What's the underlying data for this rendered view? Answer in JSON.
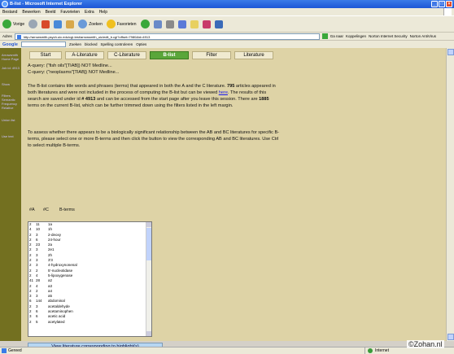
{
  "window": {
    "title": "B-list - Microsoft Internet Explorer"
  },
  "menu": [
    "Bestand",
    "Bewerken",
    "Beeld",
    "Favorieten",
    "Extra",
    "Help"
  ],
  "toolbar": {
    "back": "Vorige",
    "search": "Zoeken",
    "favorites": "Favorieten"
  },
  "address": {
    "label": "Adres",
    "url": "http://arrowsmith.psych.uic.edu/cgi-test/arrowsmith_uic/edit_b.cgi?offset=7980&id=4913",
    "go": "Ga naar",
    "links": "Koppelingen",
    "norton1": "Norton Internet Security",
    "norton2": "Norton AntiVirus"
  },
  "google_bar": {
    "logo": "Google",
    "search_btn": "Zoeken",
    "blocked": "blocked",
    "spelling": "Spelling controleren",
    "options": "Opties"
  },
  "sidebar": {
    "links": [
      "Arrowsmith Home Page",
      "Job id: 4913",
      "Show",
      "Filters Semantic Frequency Relative",
      "Union list",
      "Use text"
    ]
  },
  "tabs": [
    "Start",
    "A-Literature",
    "C-Literature",
    "B-list",
    "Filter",
    "Literature"
  ],
  "query": {
    "a": "A-query: (\"fish oils\"[TIAB]) NOT Medline...",
    "c": "C-query: (\"neoplasms\"[TIAB]) NOT Medline..."
  },
  "paragraph1": {
    "p1": "The B-list contains title words and phrases (terms) that appeared in both the A and the C literature. ",
    "count1": "795",
    "p2": " articles appeared in both literatures and were not included in the process of computing the B-list but can be viewed ",
    "here": "here",
    "p3": ". The results of this search are saved under id ",
    "id": "# 4913",
    "p4": " and can be accessed from the start page after you leave this session. There are ",
    "count2": "1885",
    "p5": " terms on the current B-list, which can be further trimmed down using the filters listed in the left margin."
  },
  "paragraph2": "To assess whether there appears to be a biologically significant relationship between the AB and BC literatures for specific B-terms, please select one or more B-terms and then click the button to view the corresponding AB and BC literatures. Use Ctrl to select multiple B-terms.",
  "columns": {
    "a": "#A",
    "c": "#C",
    "b": "B-terms"
  },
  "bterms": [
    {
      "a": "2",
      "c": "11",
      "t": "1a"
    },
    {
      "a": "4",
      "c": "10",
      "t": "1h"
    },
    {
      "a": "2",
      "c": "3",
      "t": "2-deoxy"
    },
    {
      "a": "2",
      "c": "6",
      "t": "24-hour"
    },
    {
      "a": "2",
      "c": "23",
      "t": "2a"
    },
    {
      "a": "2",
      "c": "3",
      "t": "2e1"
    },
    {
      "a": "2",
      "c": "3",
      "t": "2h"
    },
    {
      "a": "2",
      "c": "3",
      "t": "3'3"
    },
    {
      "a": "2",
      "c": "3",
      "t": "4-hydroxynonenal"
    },
    {
      "a": "2",
      "c": "2",
      "t": "5'-nucleotidase"
    },
    {
      "a": "2",
      "c": "4",
      "t": "5-lipoxygenase"
    },
    {
      "a": "41",
      "c": "28",
      "t": "a2"
    },
    {
      "a": "2",
      "c": "4",
      "t": "a3"
    },
    {
      "a": "2",
      "c": "2",
      "t": "a4"
    },
    {
      "a": "3",
      "c": "3",
      "t": "a5"
    },
    {
      "a": "6",
      "c": "144",
      "t": "abdominal"
    },
    {
      "a": "2",
      "c": "3",
      "t": "acetaldehyde"
    },
    {
      "a": "2",
      "c": "6",
      "t": "acetaminophen"
    },
    {
      "a": "3",
      "c": "6",
      "t": "acetic acid"
    },
    {
      "a": "2",
      "c": "5",
      "t": "acetylated"
    }
  ],
  "view_button": "View literature corresponding to highlight(s)",
  "status": {
    "left": "Gereed",
    "zone": "Internet"
  },
  "watermark": "©Zohan.nl"
}
